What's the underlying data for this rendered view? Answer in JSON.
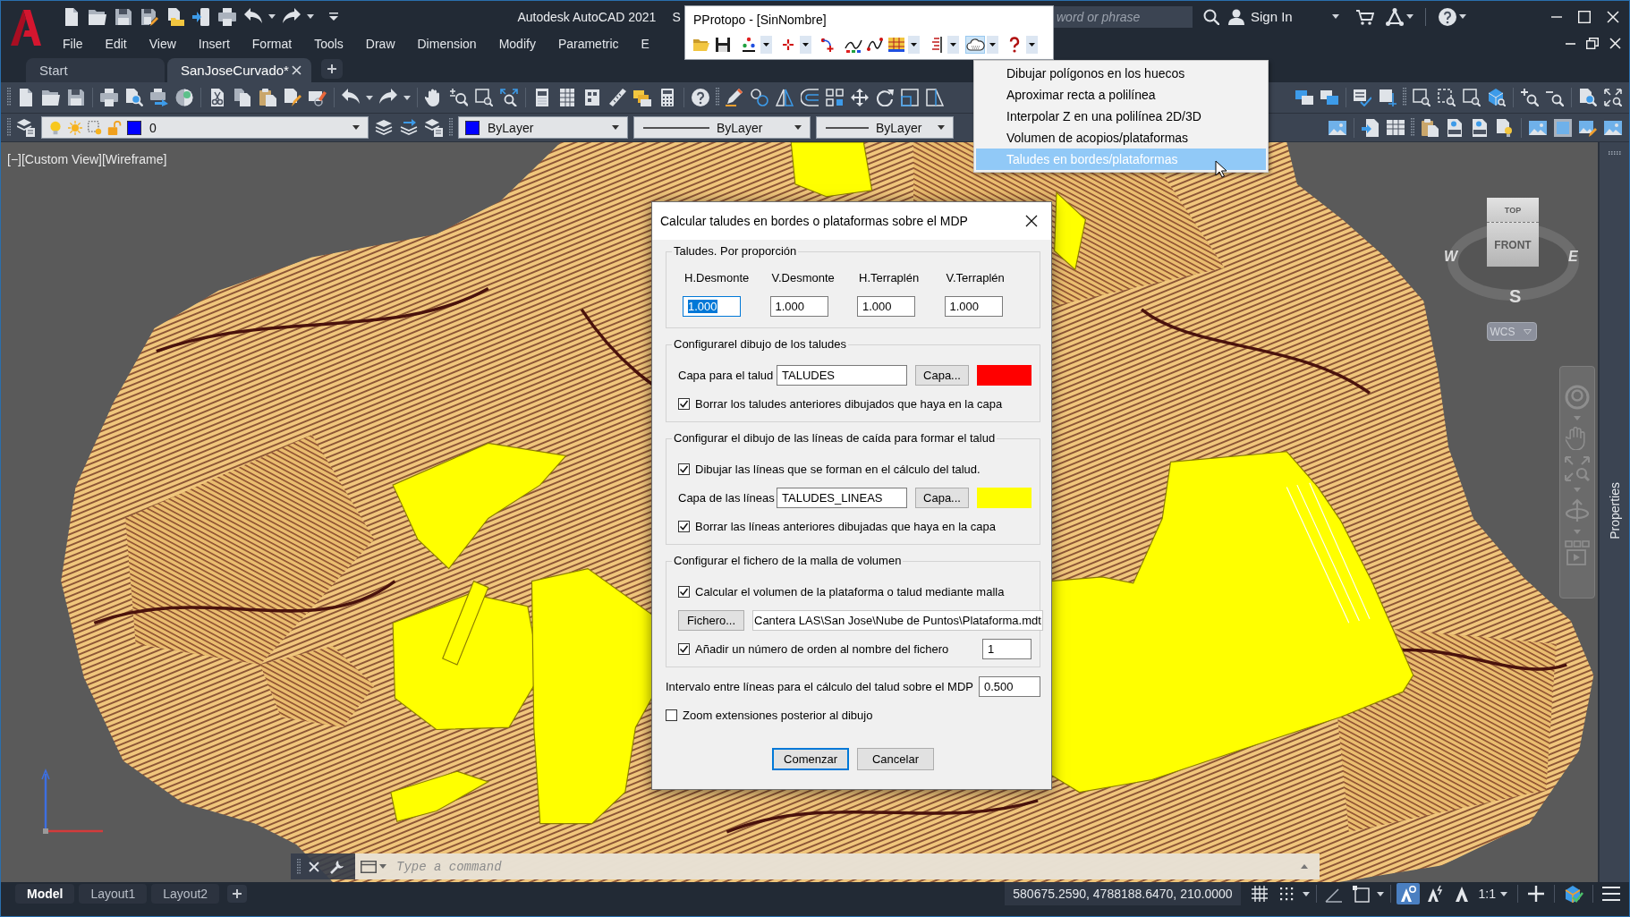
{
  "app": {
    "title": "Autodesk AutoCAD 2021",
    "document_name": "S",
    "search": {
      "placeholder": "word or phrase"
    },
    "sign_in": "Sign In"
  },
  "menu_bar": [
    "File",
    "Edit",
    "View",
    "Insert",
    "Format",
    "Tools",
    "Draw",
    "Dimension",
    "Modify",
    "Parametric",
    "E"
  ],
  "file_tabs": [
    {
      "label": "Start",
      "selected": false
    },
    {
      "label": "SanJoseCurvado*",
      "selected": true
    }
  ],
  "layer_toolbar": {
    "layer": "0",
    "color_control": "ByLayer",
    "linetype_control": "ByLayer",
    "lineweight_control": "ByLayer"
  },
  "viewport": {
    "controls": [
      "[−]",
      "[Custom View]",
      "[Wireframe]"
    ],
    "viewcube": {
      "top": "TOP",
      "front": "FRONT",
      "west": "W",
      "east": "E",
      "south": "S"
    },
    "ucs": "WCS"
  },
  "properties_palette": {
    "title": "Properties"
  },
  "command_line": {
    "placeholder": "Type a command"
  },
  "layout_tabs": [
    {
      "label": "Model",
      "selected": true
    },
    {
      "label": "Layout1",
      "selected": false
    },
    {
      "label": "Layout2",
      "selected": false
    }
  ],
  "status_bar": {
    "coordinates": "580675.2590, 4788188.6470, 210.0000",
    "toggles": [
      {
        "kind": "grid",
        "on": false
      },
      {
        "kind": "snap",
        "on": false
      },
      {
        "kind": "polar",
        "on": false
      },
      {
        "kind": "isodraft",
        "on": false
      },
      {
        "kind": "annotation_visibility",
        "on": true
      },
      {
        "kind": "autoscale",
        "on": false
      },
      {
        "kind": "annotation_scale",
        "on": false
      }
    ],
    "scale": "1:1"
  },
  "pprotopo_window": {
    "title": "PProtopo - [SinNombre]",
    "tools": [
      {
        "kind": "open",
        "pressed": false
      },
      {
        "kind": "save",
        "pressed": false
      },
      {
        "kind": "text_style",
        "pressed": false
      },
      {
        "kind": "dropdown",
        "pressed": false
      },
      {
        "kind": "point",
        "pressed": false
      },
      {
        "kind": "dropdown",
        "pressed": false
      },
      {
        "kind": "point_link",
        "pressed": false
      },
      {
        "kind": "profile",
        "pressed": false
      },
      {
        "kind": "curve",
        "pressed": false
      },
      {
        "kind": "table",
        "pressed": false
      },
      {
        "kind": "dropdown",
        "pressed": false
      },
      {
        "kind": "section",
        "pressed": false
      },
      {
        "kind": "dropdown",
        "pressed": false
      },
      {
        "kind": "cloud",
        "pressed": true
      },
      {
        "kind": "dropdown",
        "pressed": false
      },
      {
        "kind": "help",
        "pressed": false
      },
      {
        "kind": "dropdown",
        "pressed": false
      }
    ],
    "menu": [
      {
        "label": "Dibujar polígonos en los huecos",
        "selected": false
      },
      {
        "label": "Aproximar recta a polilínea",
        "selected": false
      },
      {
        "label": "Interpolar Z en una polilínea 2D/3D",
        "selected": false
      },
      {
        "label": "Volumen de acopios/plataformas",
        "selected": false
      },
      {
        "label": "Taludes en bordes/plataformas",
        "selected": true
      }
    ]
  },
  "dialog": {
    "title": "Calcular taludes en bordes o plataformas sobre el MDP",
    "groups": [
      {
        "title": "Taludes. Por proporción",
        "rows": [
          {
            "kind": "ratio_fields",
            "fields": [
              {
                "label": "H.Desmonte",
                "value": "1.000",
                "selected": true
              },
              {
                "label": "V.Desmonte",
                "value": "1.000",
                "selected": false
              },
              {
                "label": "H.Terraplén",
                "value": "1.000",
                "selected": false
              },
              {
                "label": "V.Terraplén",
                "value": "1.000",
                "selected": false
              }
            ]
          }
        ]
      },
      {
        "title": "Configurarel dibujo de los taludes",
        "rows": [
          {
            "kind": "layer",
            "label": "Capa para el talud",
            "value": "TALUDES",
            "button": "Capa...",
            "color": "#ff0000"
          },
          {
            "kind": "checkbox",
            "label": "Borrar los taludes anteriores dibujados que haya en la capa",
            "checked": true
          }
        ]
      },
      {
        "title": "Configurar el dibujo de las líneas de caída para formar el talud",
        "rows": [
          {
            "kind": "checkbox",
            "label": "Dibujar las líneas que se forman en el cálculo del talud.",
            "checked": true
          },
          {
            "kind": "layer",
            "label": "Capa de las líneas",
            "value": "TALUDES_LINEAS",
            "button": "Capa...",
            "color": "#ffff00"
          },
          {
            "kind": "checkbox",
            "label": "Borrar las líneas anteriores dibujadas que haya en la capa",
            "checked": true
          }
        ]
      },
      {
        "title": "Configurar el fichero de la malla de volumen",
        "rows": [
          {
            "kind": "checkbox",
            "label": "Calcular el volumen de la plataforma o talud mediante malla",
            "checked": true
          },
          {
            "kind": "file",
            "button": "Fichero...",
            "value": "Cantera LAS\\San Jose\\Nube de Puntos\\Plataforma.mdt"
          },
          {
            "kind": "numbered_checkbox",
            "label": "Añadir un número de orden al nombre del fichero",
            "checked": true,
            "value": "1"
          }
        ]
      }
    ],
    "rows": [
      {
        "kind": "field",
        "label": "Intervalo entre líneas para el cálculo del talud sobre el MDP",
        "value": "0.500"
      },
      {
        "kind": "checkbox",
        "label": "Zoom extensiones posterior al dibujo",
        "checked": false
      }
    ],
    "buttons": [
      {
        "label": "Comenzar",
        "default": true
      },
      {
        "label": "Cancelar",
        "default": false
      }
    ]
  }
}
